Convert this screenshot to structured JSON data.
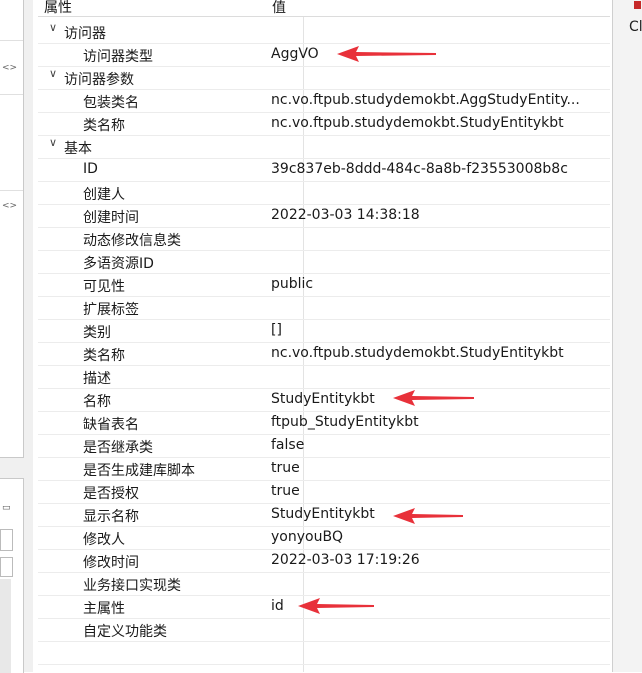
{
  "headers": {
    "property": "属性",
    "value": "值"
  },
  "rows": [
    {
      "type": "group",
      "label": "访问器"
    },
    {
      "type": "item",
      "label": "访问器类型",
      "value": "AggVO",
      "indent": 1
    },
    {
      "type": "group",
      "label": "访问器参数"
    },
    {
      "type": "item",
      "label": "包装类名",
      "value": "nc.vo.ftpub.studydemokbt.AggStudyEntity...",
      "indent": 1
    },
    {
      "type": "item",
      "label": "类名称",
      "value": "nc.vo.ftpub.studydemokbt.StudyEntitykbt",
      "indent": 1
    },
    {
      "type": "group",
      "label": "基本"
    },
    {
      "type": "item",
      "label": "ID",
      "value": "39c837eb-8ddd-484c-8a8b-f23553008b8c",
      "indent": 1
    },
    {
      "type": "item",
      "label": "创建人",
      "value": "",
      "indent": 1
    },
    {
      "type": "item",
      "label": "创建时间",
      "value": "2022-03-03 14:38:18",
      "indent": 1
    },
    {
      "type": "item",
      "label": "动态修改信息类",
      "value": "",
      "indent": 1
    },
    {
      "type": "item",
      "label": "多语资源ID",
      "value": "",
      "indent": 1
    },
    {
      "type": "item",
      "label": "可见性",
      "value": "public",
      "indent": 1
    },
    {
      "type": "item",
      "label": "扩展标签",
      "value": "",
      "indent": 1
    },
    {
      "type": "item",
      "label": "类别",
      "value": "[]",
      "indent": 1
    },
    {
      "type": "item",
      "label": "类名称",
      "value": "nc.vo.ftpub.studydemokbt.StudyEntitykbt",
      "indent": 1
    },
    {
      "type": "item",
      "label": "描述",
      "value": "",
      "indent": 1
    },
    {
      "type": "item",
      "label": "名称",
      "value": "StudyEntitykbt",
      "indent": 1
    },
    {
      "type": "item",
      "label": "缺省表名",
      "value": "ftpub_StudyEntitykbt",
      "indent": 1
    },
    {
      "type": "item",
      "label": "是否继承类",
      "value": "false",
      "indent": 1
    },
    {
      "type": "item",
      "label": "是否生成建库脚本",
      "value": "true",
      "indent": 1
    },
    {
      "type": "item",
      "label": "是否授权",
      "value": "true",
      "indent": 1
    },
    {
      "type": "item",
      "label": "显示名称",
      "value": "StudyEntitykbt",
      "indent": 1
    },
    {
      "type": "item",
      "label": "修改人",
      "value": "yonyouBQ",
      "indent": 1
    },
    {
      "type": "item",
      "label": "修改时间",
      "value": "2022-03-03 17:19:26",
      "indent": 1
    },
    {
      "type": "item",
      "label": "业务接口实现类",
      "value": "",
      "indent": 1
    },
    {
      "type": "item",
      "label": "主属性",
      "value": "id",
      "indent": 1
    },
    {
      "type": "item",
      "label": "自定义功能类",
      "value": "",
      "indent": 1
    },
    {
      "type": "item",
      "label": "",
      "value": "",
      "indent": 1
    }
  ],
  "right_pane": {
    "text": "Cl"
  },
  "colors": {
    "arrow": "#e8313a",
    "chevron": "#444444"
  }
}
